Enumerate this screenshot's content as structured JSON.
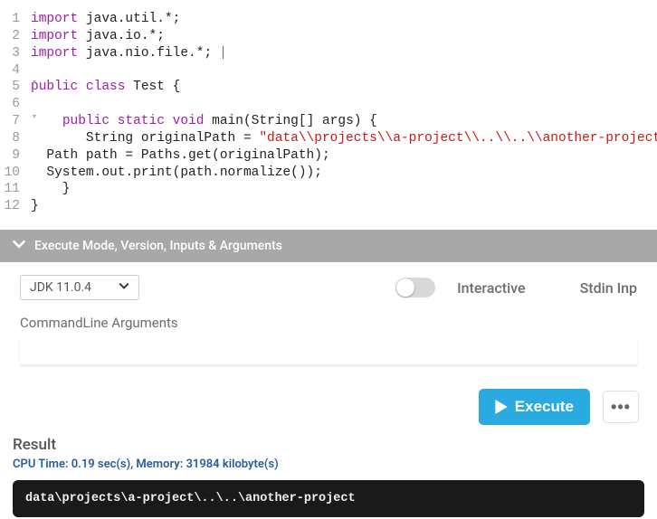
{
  "editor": {
    "lines": [
      {
        "n": 1,
        "fold": "",
        "tokens": [
          [
            "kw",
            "import"
          ],
          [
            "",
            " java.util.*;"
          ]
        ]
      },
      {
        "n": 2,
        "fold": "",
        "tokens": [
          [
            "kw",
            "import"
          ],
          [
            "",
            " java.io.*;"
          ]
        ]
      },
      {
        "n": 3,
        "fold": "",
        "tokens": [
          [
            "kw",
            "import"
          ],
          [
            "",
            " java.nio.file.*; "
          ]
        ],
        "cursor": true
      },
      {
        "n": 4,
        "fold": "",
        "tokens": [
          [
            "",
            ""
          ]
        ]
      },
      {
        "n": 5,
        "fold": "▾",
        "tokens": [
          [
            "kw",
            "public class"
          ],
          [
            "",
            " "
          ],
          [
            "cls",
            "Test"
          ],
          [
            "",
            " {"
          ]
        ]
      },
      {
        "n": 6,
        "fold": "",
        "tokens": [
          [
            "",
            ""
          ]
        ]
      },
      {
        "n": 7,
        "fold": "▾",
        "tokens": [
          [
            "",
            "    "
          ],
          [
            "kw",
            "public static void"
          ],
          [
            "",
            " main(String[] args) {"
          ]
        ]
      },
      {
        "n": 8,
        "fold": "",
        "tokens": [
          [
            "",
            "       String originalPath = "
          ],
          [
            "str",
            "\"data\\\\projects\\\\a-project\\\\..\\\\..\\\\another-project\""
          ],
          [
            "",
            ";"
          ]
        ]
      },
      {
        "n": 9,
        "fold": "",
        "tokens": [
          [
            "",
            "  Path path = Paths.get(originalPath);"
          ]
        ]
      },
      {
        "n": 10,
        "fold": "",
        "tokens": [
          [
            "",
            "  System.out.print(path.normalize());"
          ]
        ]
      },
      {
        "n": 11,
        "fold": "",
        "tokens": [
          [
            "",
            "    }"
          ]
        ]
      },
      {
        "n": 12,
        "fold": "",
        "tokens": [
          [
            "",
            "}"
          ]
        ]
      }
    ]
  },
  "collapse": {
    "label": "Execute Mode, Version, Inputs & Arguments"
  },
  "config": {
    "jdk": "JDK 11.0.4",
    "interactive_label": "Interactive",
    "stdin_label": "Stdin Inp",
    "args_label": "CommandLine Arguments",
    "args_value": ""
  },
  "actions": {
    "execute_label": "Execute",
    "more_label": "•••"
  },
  "result": {
    "title": "Result",
    "stats": "CPU Time: 0.19 sec(s), Memory: 31984 kilobyte(s)",
    "output": "data\\projects\\a-project\\..\\..\\another-project"
  }
}
